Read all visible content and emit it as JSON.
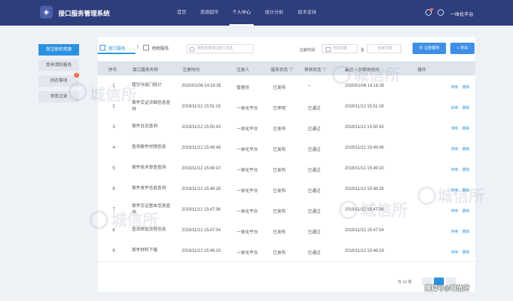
{
  "header": {
    "app_title": "接口服务管理系统",
    "nav": [
      "首页",
      "资源超市",
      "个人中心",
      "统计分析",
      "技术支持"
    ],
    "active_nav": "个人中心",
    "user_name": "一体化平台",
    "notification_icon": "bell-icon",
    "user_icon": "user-circle-icon"
  },
  "sidebar": {
    "items": [
      "我注册的资源",
      "我申请的服务",
      "待办事项",
      "审批记录"
    ],
    "active": "我注册的资源",
    "badge": "2"
  },
  "toolbar": {
    "tabs": [
      "接口服务",
      "地图服务"
    ],
    "active_tab": "接口服务",
    "search_placeholder": "服务名称或注册人姓名",
    "reg_time_label": "注册时间",
    "start_placeholder": "开始日期",
    "to_label": "至",
    "end_placeholder": "结束日期",
    "register_button": "注册服务",
    "export_button": "导出"
  },
  "table": {
    "headers": [
      "序号",
      "接口服务名称",
      "注册时间",
      "注册人",
      "服务状态",
      "审核状态",
      "最近一次修改时间",
      "操作"
    ],
    "rows": [
      {
        "no": "1",
        "name": "楼宇分层门统计",
        "reg_time": "2020/01/06 14:18:35",
        "registrant": "管理员",
        "status": "已发布",
        "audit": "--",
        "modified": "2020/01/06 14:18:35",
        "actions": [
          "停用",
          "删除"
        ]
      },
      {
        "no": "2",
        "name": "案件交证详细信息查询",
        "reg_time": "2019/11/12 15:51:18",
        "registrant": "一体化平台",
        "status": "已停用",
        "audit": "已通过",
        "modified": "2019/11/12 15:51:18",
        "actions": [
          "启用",
          "删除"
        ]
      },
      {
        "no": "3",
        "name": "案件日志查询",
        "reg_time": "2019/11/12 15:50:43",
        "registrant": "一体化平台",
        "status": "已发布",
        "audit": "已通过",
        "modified": "2019/11/12 15:50:43",
        "actions": [
          "停用",
          "删除"
        ]
      },
      {
        "no": "4",
        "name": "查询案件时限信息",
        "reg_time": "2019/11/12 15:49:49",
        "registrant": "一体化平台",
        "status": "已发布",
        "audit": "已通过",
        "modified": "2019/11/12 15:49:49",
        "actions": [
          "停用",
          "删除"
        ]
      },
      {
        "no": "5",
        "name": "案件技术审查查询",
        "reg_time": "2019/11/12 15:49:10",
        "registrant": "一体化平台",
        "status": "已发布",
        "audit": "已通过",
        "modified": "2019/11/12 15:49:10",
        "actions": [
          "停用",
          "删除"
        ]
      },
      {
        "no": "6",
        "name": "案件发件信息查询",
        "reg_time": "2019/11/12 15:48:28",
        "registrant": "一体化平台",
        "status": "已发布",
        "audit": "已通过",
        "modified": "2019/11/12 15:48:28",
        "actions": [
          "停用",
          "删除"
        ]
      },
      {
        "no": "7",
        "name": "案件交证基本信息查询",
        "reg_time": "2019/11/12 15:47:36",
        "registrant": "一体化平台",
        "status": "已发布",
        "audit": "已通过",
        "modified": "2019/11/12 15:47:36",
        "actions": [
          "停用",
          "删除"
        ]
      },
      {
        "no": "8",
        "name": "查询审批流程信息",
        "reg_time": "2019/11/12 15:47:04",
        "registrant": "一体化平台",
        "status": "已发布",
        "audit": "已通过",
        "modified": "2019/11/12 15:47:04",
        "actions": [
          "停用",
          "删除"
        ]
      },
      {
        "no": "9",
        "name": "案件材料下载",
        "reg_time": "2019/11/12 15:46:19",
        "registrant": "一体化平台",
        "status": "已发布",
        "audit": "已通过",
        "modified": "2019/11/12 15:46:19",
        "actions": [
          "停用",
          "删除"
        ]
      }
    ]
  },
  "pagination": {
    "total": "共 10 条"
  },
  "watermark_text": "城信所",
  "corner_text": "搜狐号@城信所",
  "colors": {
    "header_bg": "#2e3d7c",
    "primary": "#2b92e0",
    "badge": "#f0643c"
  }
}
